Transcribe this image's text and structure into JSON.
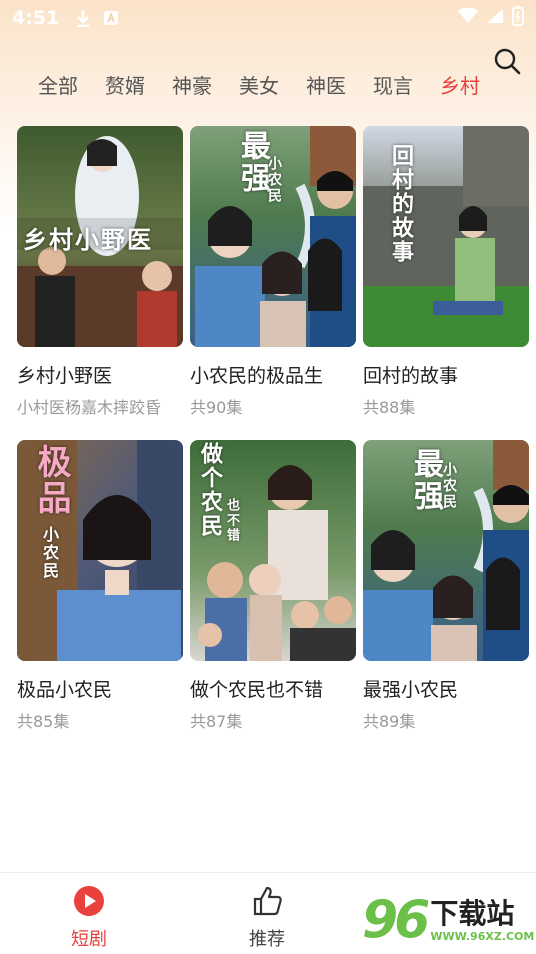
{
  "status_bar": {
    "time": "4:51"
  },
  "tabs": [
    {
      "label": "全部",
      "active": false
    },
    {
      "label": "赘婿",
      "active": false
    },
    {
      "label": "神豪",
      "active": false
    },
    {
      "label": "美女",
      "active": false
    },
    {
      "label": "神医",
      "active": false
    },
    {
      "label": "现言",
      "active": false
    },
    {
      "label": "乡村",
      "active": true
    }
  ],
  "cards": [
    {
      "title": "乡村小野医",
      "subtitle": "小村医杨嘉木摔跤昏",
      "poster_text": "乡村小野医"
    },
    {
      "title": "小农民的极品生",
      "subtitle": "共90集",
      "poster_text": "最强",
      "poster_text2": "小农民"
    },
    {
      "title": "回村的故事",
      "subtitle": "共88集",
      "poster_text": "回村的故事"
    },
    {
      "title": "极品小农民",
      "subtitle": "共85集",
      "poster_text": "极品",
      "poster_text2": "小农民"
    },
    {
      "title": "做个农民也不错",
      "subtitle": "共87集",
      "poster_text": "做个农民",
      "poster_text2": "也不错"
    },
    {
      "title": "最强小农民",
      "subtitle": "共89集",
      "poster_text": "最强",
      "poster_text2": "小农民"
    }
  ],
  "bottom_nav": [
    {
      "label": "短剧",
      "icon": "play-circle-icon",
      "active": true
    },
    {
      "label": "推荐",
      "icon": "thumbs-up-icon",
      "active": false
    }
  ],
  "watermark": {
    "number": "96",
    "name": "下载站",
    "url": "WWW.96XZ.COM"
  },
  "colors": {
    "accent": "#e8413e",
    "watermark_green": "#6cc04a"
  }
}
